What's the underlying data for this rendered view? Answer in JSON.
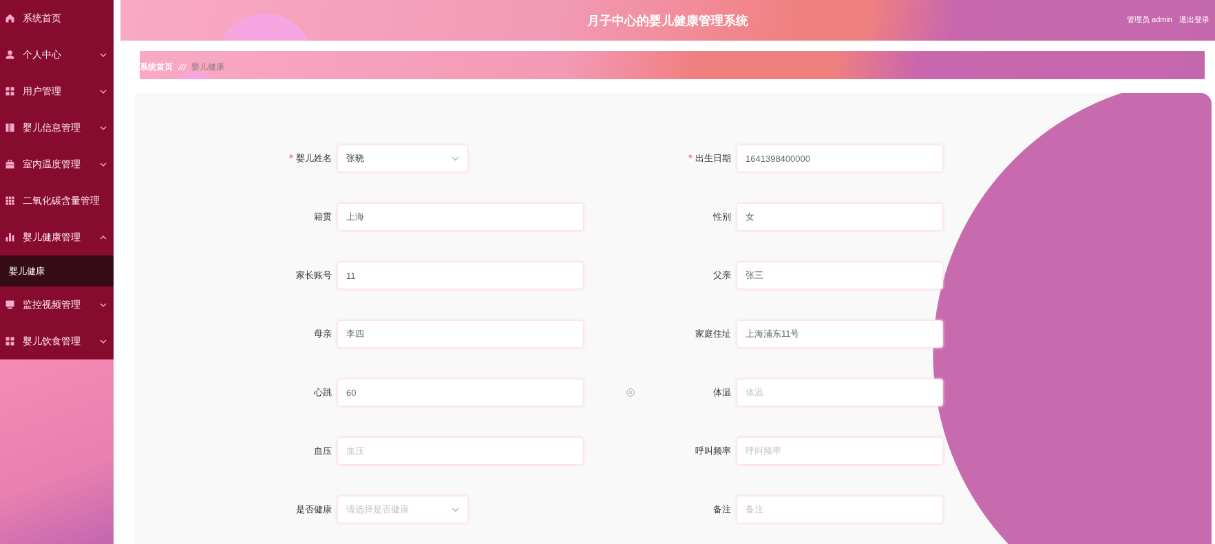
{
  "header": {
    "title": "月子中心的婴儿健康管理系统",
    "user": "管理员 admin",
    "logout": "退出登录"
  },
  "sidebar": {
    "items": [
      {
        "kind": "link",
        "label": "系统首页"
      },
      {
        "kind": "menu",
        "label": "个人中心",
        "expanded": false
      },
      {
        "kind": "menu",
        "label": "用户管理",
        "expanded": false
      },
      {
        "kind": "menu",
        "label": "婴儿信息管理",
        "expanded": false
      },
      {
        "kind": "menu",
        "label": "室内温度管理",
        "expanded": false
      },
      {
        "kind": "link",
        "label": "二氧化碳含量管理"
      },
      {
        "kind": "menu",
        "label": "婴儿健康管理",
        "expanded": true,
        "children": [
          {
            "label": "婴儿健康",
            "selected": true
          }
        ]
      },
      {
        "kind": "menu",
        "label": "监控视频管理",
        "expanded": false
      },
      {
        "kind": "menu",
        "label": "婴儿饮食管理",
        "expanded": false
      }
    ]
  },
  "breadcrumb": {
    "items": [
      "系统首页",
      "婴儿健康"
    ],
    "separator": "///"
  },
  "form": {
    "fields": [
      {
        "label": "婴儿姓名",
        "kind": "select",
        "required": true,
        "value": "张晓",
        "clearable": false
      },
      {
        "label": "出生日期",
        "kind": "input",
        "required": true,
        "value": "1641398400000",
        "clearable": false
      },
      {
        "label": "籍贯",
        "kind": "input",
        "required": false,
        "value": "上海",
        "clearable": false
      },
      {
        "label": "性别",
        "kind": "input",
        "required": false,
        "value": "女",
        "clearable": false
      },
      {
        "label": "家长账号",
        "kind": "input",
        "required": false,
        "value": "11",
        "clearable": false
      },
      {
        "label": "父亲",
        "kind": "input",
        "required": false,
        "value": "张三",
        "clearable": false
      },
      {
        "label": "母亲",
        "kind": "input",
        "required": false,
        "value": "李四",
        "clearable": false
      },
      {
        "label": "家庭住址",
        "kind": "input",
        "required": false,
        "value": "上海浦东11号",
        "clearable": false
      },
      {
        "label": "心跳",
        "kind": "input",
        "required": false,
        "value": "60",
        "clearable": true
      },
      {
        "label": "体温",
        "kind": "input",
        "required": false,
        "placeholder": "体温",
        "clearable": false
      },
      {
        "label": "血压",
        "kind": "input",
        "required": false,
        "placeholder": "血压",
        "clearable": false
      },
      {
        "label": "呼叫频率",
        "kind": "input",
        "required": false,
        "placeholder": "呼叫频率",
        "clearable": false
      },
      {
        "label": "是否健康",
        "kind": "select",
        "required": false,
        "placeholder": "请选择是否健康",
        "clearable": false
      },
      {
        "label": "备注",
        "kind": "input",
        "required": false,
        "placeholder": "备注",
        "clearable": false
      }
    ]
  }
}
